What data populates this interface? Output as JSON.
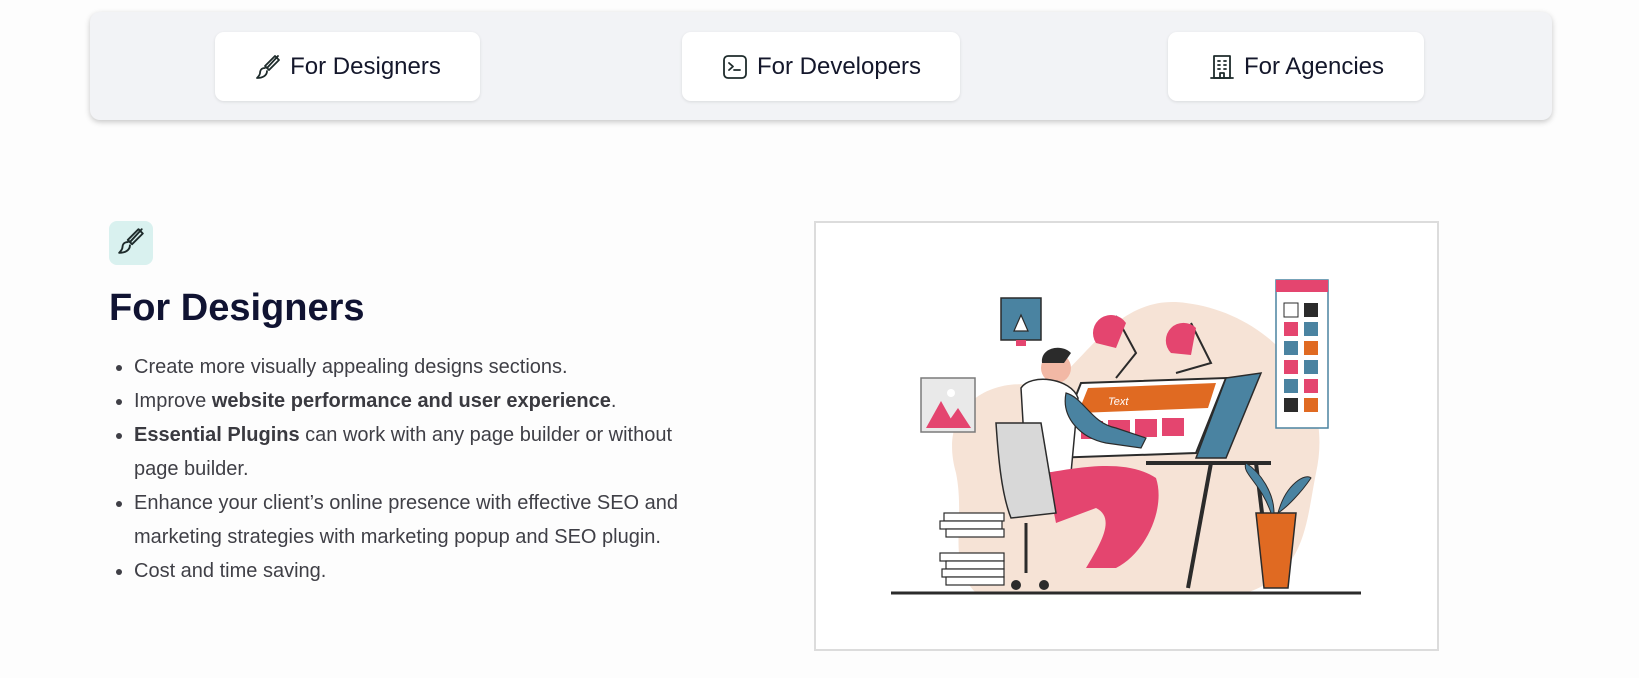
{
  "tabs": [
    {
      "label": "For Designers",
      "icon": "brush-icon"
    },
    {
      "label": "For Developers",
      "icon": "terminal-icon"
    },
    {
      "label": "For Agencies",
      "icon": "building-icon"
    }
  ],
  "section": {
    "icon": "brush-icon",
    "title": "For Designers",
    "bullets": [
      {
        "pre": "Create more visually appealing designs sections.",
        "bold": "",
        "post": ""
      },
      {
        "pre": "Improve ",
        "bold": "website performance and user experience",
        "post": "."
      },
      {
        "pre": "",
        "bold": "Essential Plugins",
        "post": " can work with any page builder or without page builder."
      },
      {
        "pre": "Enhance your client’s online presence with effective SEO and marketing strategies with marketing popup and SEO plugin.",
        "bold": "",
        "post": ""
      },
      {
        "pre": "Cost and time saving.",
        "bold": "",
        "post": ""
      }
    ],
    "illustration": {
      "subject": "designer-at-desk-illustration",
      "screen_text": "Text"
    }
  },
  "colors": {
    "accent_pink": "#e4456f",
    "accent_teal": "#4a83a1",
    "accent_orange": "#e06a22",
    "badge_bg": "#d9f1ef",
    "title": "#101332"
  }
}
